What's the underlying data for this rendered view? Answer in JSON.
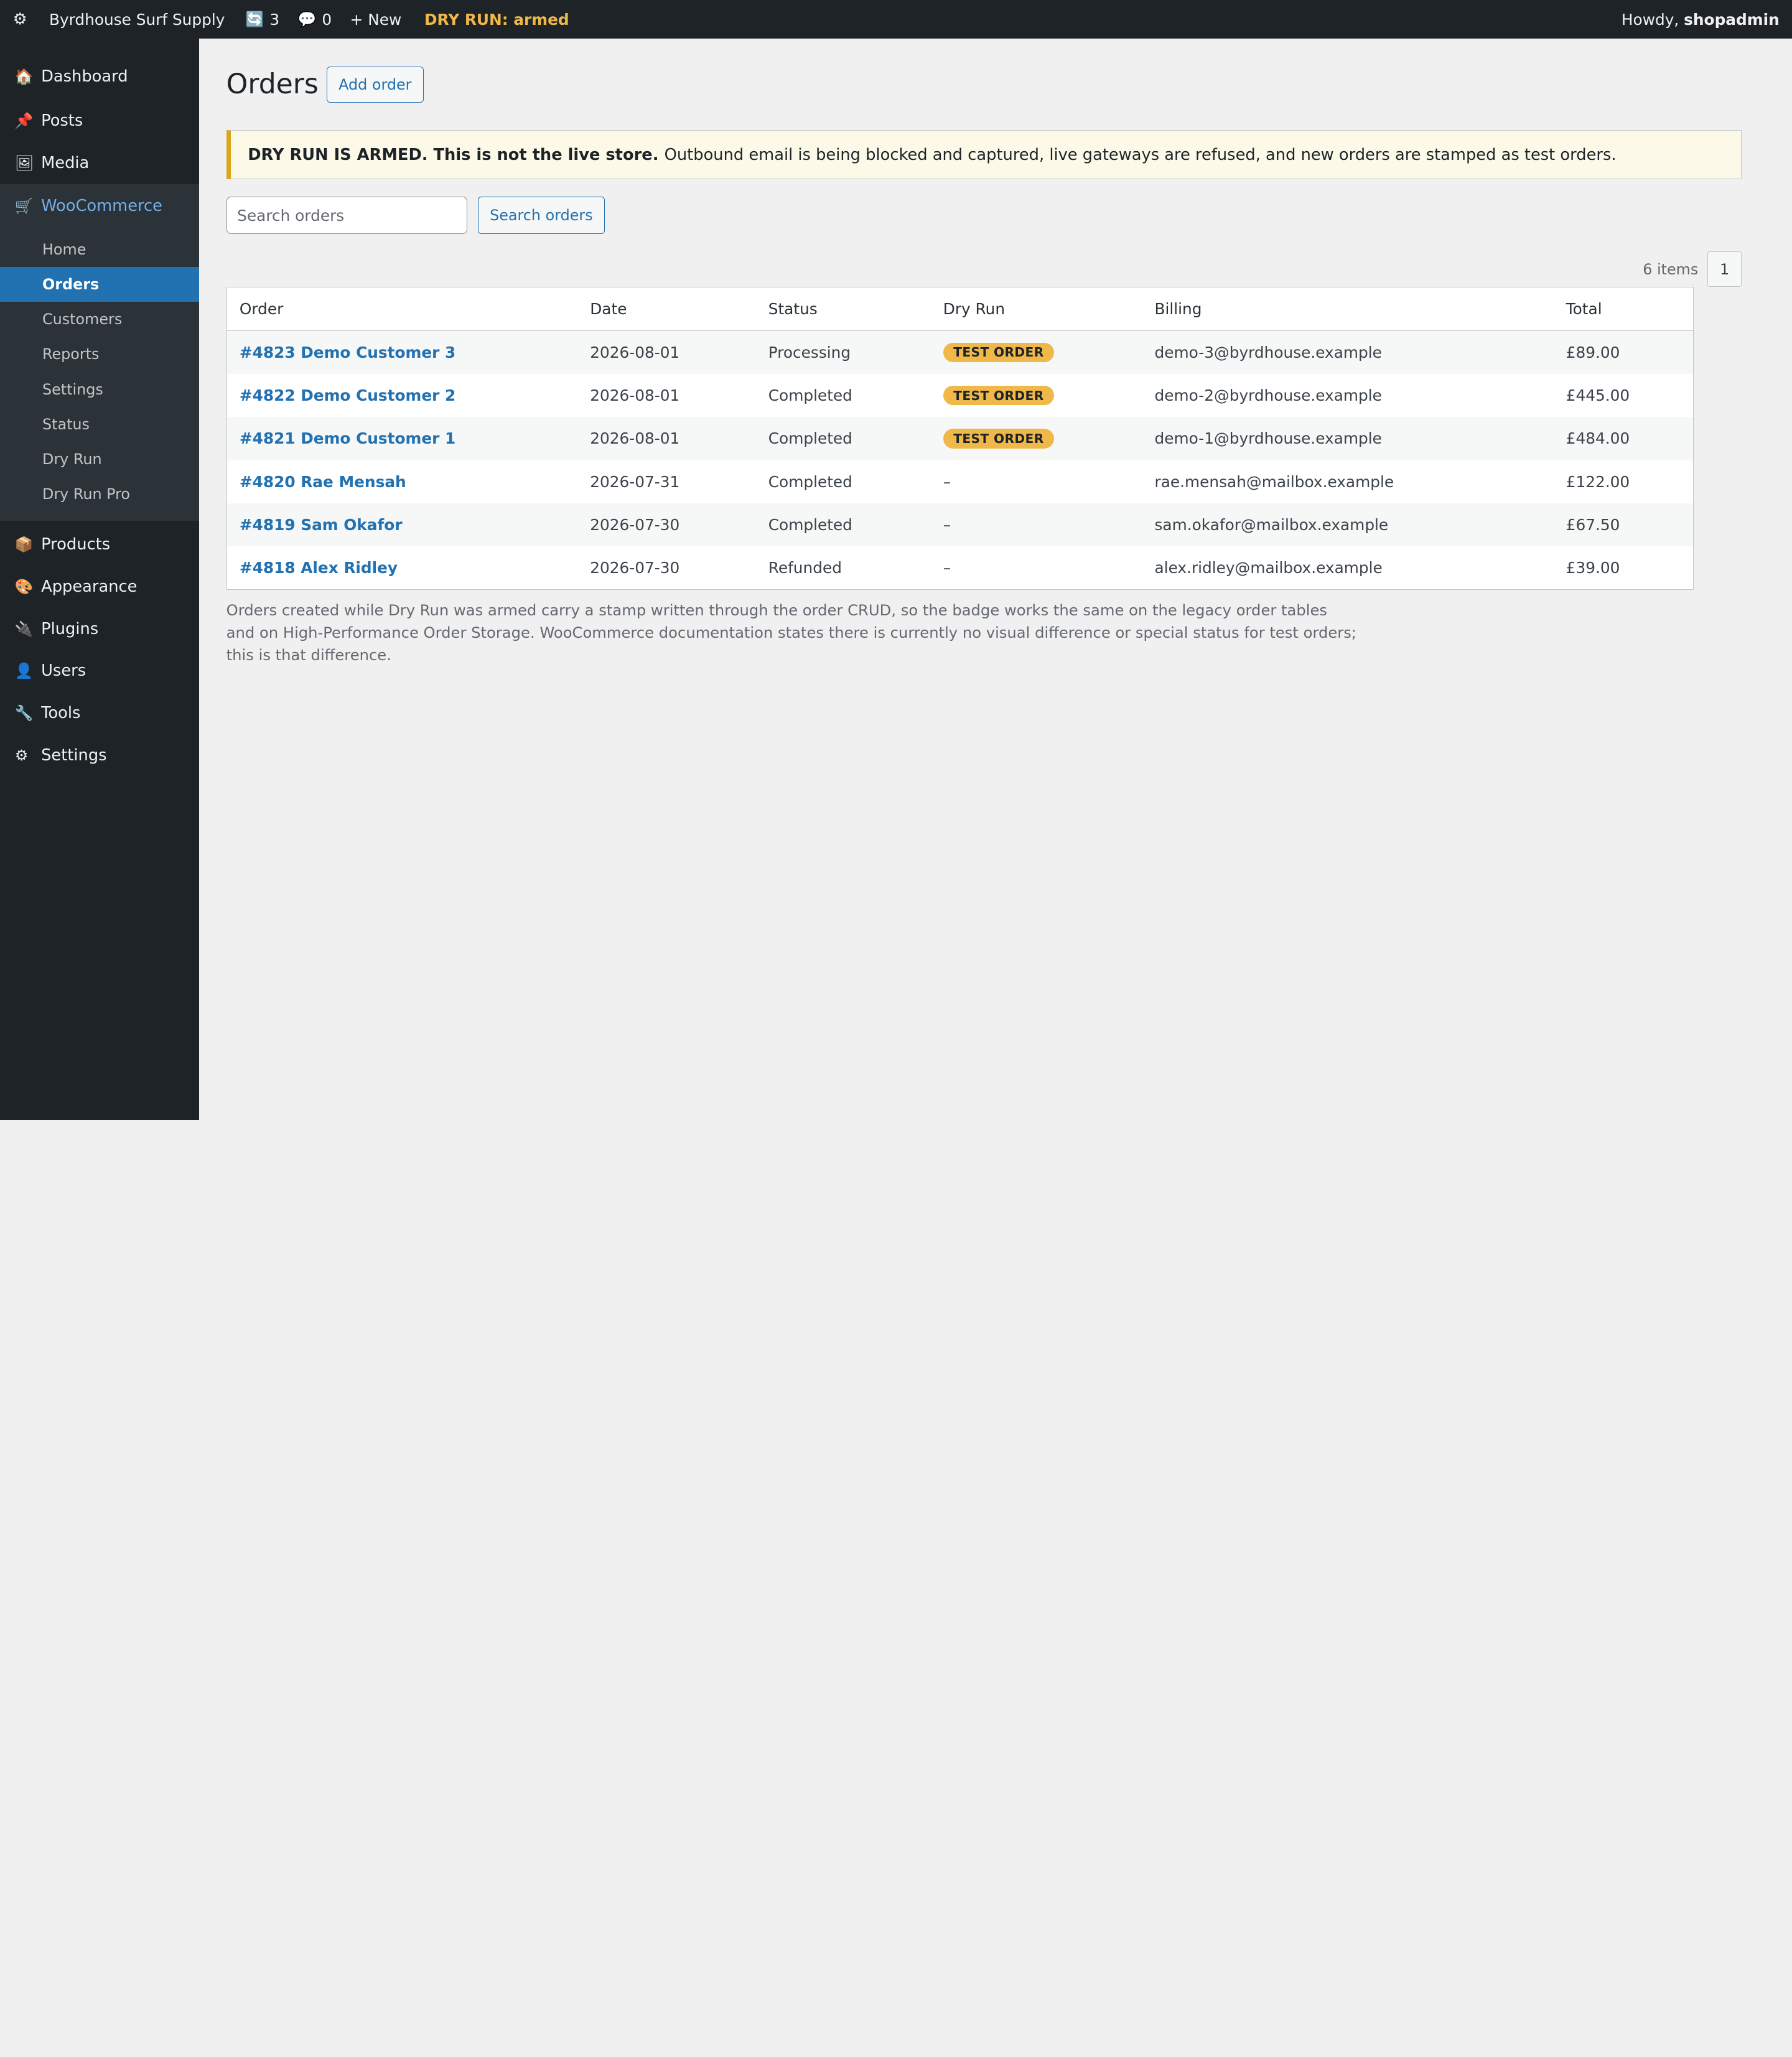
{
  "admin_bar": {
    "wp_icon": "gear-icon",
    "site_name": "Byrdhouse Surf Supply",
    "updates_count": "3",
    "comments_count": "0",
    "new_label": "+ New",
    "dry_run_label": "DRY RUN: armed",
    "howdy_prefix": "Howdy,",
    "username": "shopadmin"
  },
  "sidebar": {
    "dashboard": "Dashboard",
    "posts": "Posts",
    "media": "Media",
    "woocommerce": "WooCommerce",
    "woo_sub": [
      "Home",
      "Orders",
      "Customers",
      "Reports",
      "Settings",
      "Status",
      "Dry Run",
      "Dry Run Pro"
    ],
    "products": "Products",
    "appearance": "Appearance",
    "plugins": "Plugins",
    "users": "Users",
    "tools": "Tools",
    "settings": "Settings"
  },
  "page": {
    "title": "Orders",
    "add_button": "Add order"
  },
  "notice": {
    "bold": "DRY RUN IS ARMED. This is not the live store.",
    "text": "Outbound email is being blocked and captured, live gateways are refused, and new orders are stamped as test orders.",
    "accent_color": "#dba617"
  },
  "search": {
    "placeholder": "Search orders",
    "button": "Search orders"
  },
  "pagination": {
    "items": "6 items",
    "page": "1"
  },
  "table": {
    "columns": [
      "Order",
      "Date",
      "Status",
      "Dry Run",
      "Billing",
      "Total"
    ],
    "rows": [
      {
        "order": "#4823 Demo Customer 3",
        "date": "2026-08-01",
        "status": "Processing",
        "dry_run": "TEST ORDER",
        "billing": "demo-3@byrdhouse.example",
        "total": "£89.00"
      },
      {
        "order": "#4822 Demo Customer 2",
        "date": "2026-08-01",
        "status": "Completed",
        "dry_run": "TEST ORDER",
        "billing": "demo-2@byrdhouse.example",
        "total": "£445.00"
      },
      {
        "order": "#4821 Demo Customer 1",
        "date": "2026-08-01",
        "status": "Completed",
        "dry_run": "TEST ORDER",
        "billing": "demo-1@byrdhouse.example",
        "total": "£484.00"
      },
      {
        "order": "#4820 Rae Mensah",
        "date": "2026-07-31",
        "status": "Completed",
        "dry_run": "–",
        "billing": "rae.mensah@mailbox.example",
        "total": "£122.00"
      },
      {
        "order": "#4819 Sam Okafor",
        "date": "2026-07-30",
        "status": "Completed",
        "dry_run": "–",
        "billing": "sam.okafor@mailbox.example",
        "total": "£67.50"
      },
      {
        "order": "#4818 Alex Ridley",
        "date": "2026-07-30",
        "status": "Refunded",
        "dry_run": "–",
        "billing": "alex.ridley@mailbox.example",
        "total": "£39.00"
      }
    ]
  },
  "footnote": "Orders created while Dry Run was armed carry a stamp written through the order CRUD, so the badge works the same on the legacy order tables and on High-Performance Order Storage. WooCommerce documentation states there is currently no visual difference or special status for test orders; this is that difference.",
  "colors": {
    "admin_bg": "#1d2327",
    "accent_blue": "#2271b1",
    "badge_yellow": "#f0b849"
  }
}
